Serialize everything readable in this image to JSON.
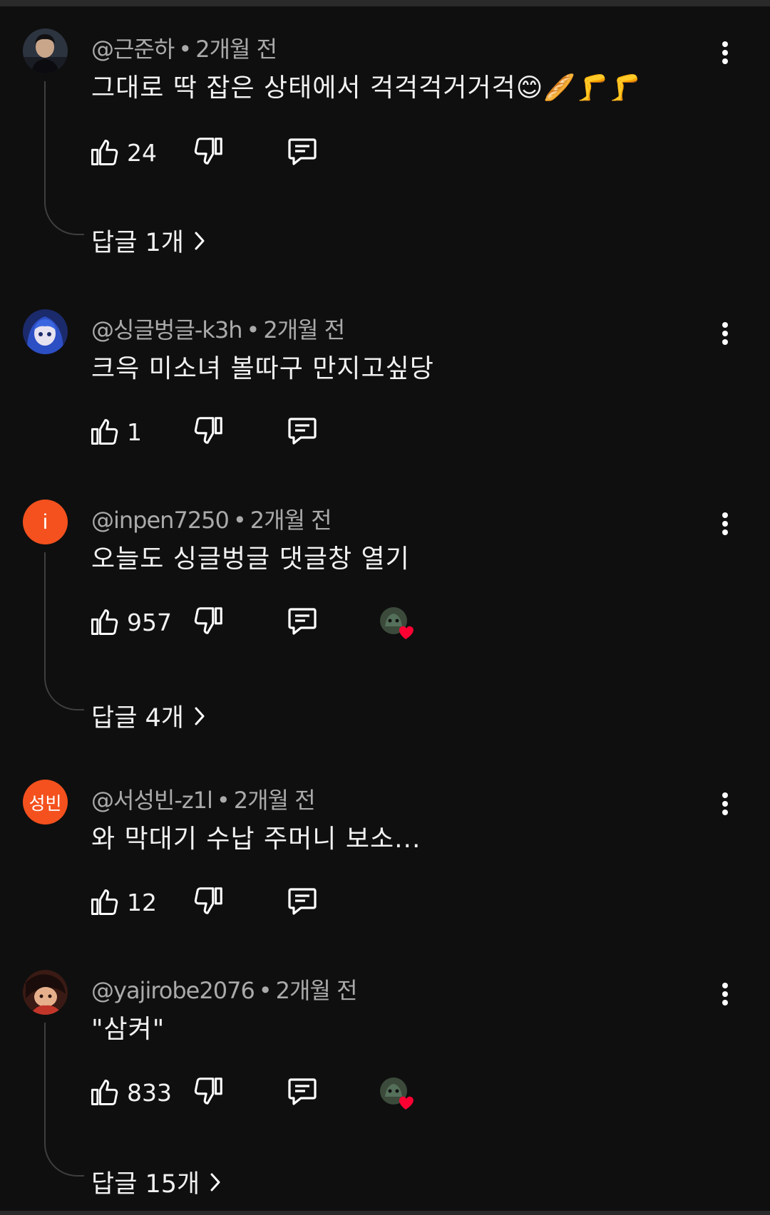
{
  "comments": [
    {
      "author": "@근준하",
      "time": "2개월 전",
      "text": "그대로 딱 잡은 상태에서 걱걱걱거거걱😊🥖🦵🦵",
      "likes": "24",
      "replies_label": "답글 1개",
      "avatar_icon": "photo-avatar"
    },
    {
      "author": "@싱글벙글-k3h",
      "time": "2개월 전",
      "text": "크윽 미소녀 볼따구 만지고싶당",
      "likes": "1",
      "avatar_icon": "anime-avatar"
    },
    {
      "author": "@inpen7250",
      "time": "2개월 전",
      "text": "오늘도 싱글벙글 댓글창 열기",
      "likes": "957",
      "replies_label": "답글 4개",
      "avatar_letter": "i",
      "has_creator_heart": true
    },
    {
      "author": "@서성빈-z1l",
      "time": "2개월 전",
      "text": "와 막대기 수납 주머니 보소...",
      "likes": "12",
      "avatar_letter": "성빈"
    },
    {
      "author": "@yajirobe2076",
      "time": "2개월 전",
      "text": "\"삼켜\"",
      "likes": "833",
      "replies_label": "답글 15개",
      "avatar_icon": "character-avatar",
      "has_creator_heart": true
    }
  ],
  "icons": {
    "like": "thumbs-up-icon",
    "dislike": "thumbs-down-icon",
    "reply": "reply-icon",
    "more": "more-vert-icon",
    "chevron": "chevron-right-icon",
    "heart": "creator-heart-icon"
  },
  "colors": {
    "background": "#0f0f0f",
    "text": "#f1f1f1",
    "meta": "#aaaaaa",
    "avatar_orange": "#f4511e",
    "heart_red": "#ff0033"
  }
}
